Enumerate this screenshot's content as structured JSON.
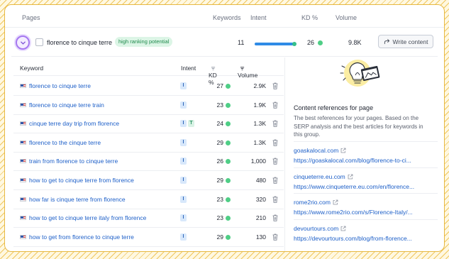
{
  "header": {
    "pages_label": "Pages",
    "keywords_label": "Keywords",
    "intent_label": "Intent",
    "kd_label": "KD %",
    "volume_label": "Volume"
  },
  "page_row": {
    "title": "florence to cinque terre",
    "badge": "high ranking potential",
    "keywords": "11",
    "intent_fill": 0.95,
    "kd": "26",
    "volume": "9.8K",
    "write_label": "Write content"
  },
  "table": {
    "columns": {
      "keyword": "Keyword",
      "intent": "Intent",
      "kd": "KD %",
      "volume": "Volume"
    },
    "rows": [
      {
        "keyword": "florence to cinque terre",
        "intents": [
          "I"
        ],
        "kd": "27",
        "volume": "2.9K"
      },
      {
        "keyword": "florence to cinque terre train",
        "intents": [
          "I"
        ],
        "kd": "23",
        "volume": "1.9K"
      },
      {
        "keyword": "cinque terre day trip from florence",
        "intents": [
          "I",
          "T"
        ],
        "kd": "24",
        "volume": "1.3K"
      },
      {
        "keyword": "florence to the cinque terre",
        "intents": [
          "I"
        ],
        "kd": "29",
        "volume": "1.3K"
      },
      {
        "keyword": "train from florence to cinque terre",
        "intents": [
          "I"
        ],
        "kd": "26",
        "volume": "1,000"
      },
      {
        "keyword": "how to get to cinque terre from florence",
        "intents": [
          "I"
        ],
        "kd": "29",
        "volume": "480"
      },
      {
        "keyword": "how far is cinque terre from florence",
        "intents": [
          "I"
        ],
        "kd": "23",
        "volume": "320"
      },
      {
        "keyword": "how to get to cinque terre italy from florence",
        "intents": [
          "I"
        ],
        "kd": "23",
        "volume": "210"
      },
      {
        "keyword": "how to get from florence to cinque terre",
        "intents": [
          "I"
        ],
        "kd": "29",
        "volume": "130"
      }
    ]
  },
  "references": {
    "title": "Content references for page",
    "description": "The best references for your pages. Based on the SERP analysis and the best articles for keywords in this group.",
    "items": [
      {
        "domain": "goaskalocal.com",
        "url": "https://goaskalocal.com/blog/florence-to-ci..."
      },
      {
        "domain": "cinqueterre.eu.com",
        "url": "https://www.cinqueterre.eu.com/en/florence..."
      },
      {
        "domain": "rome2rio.com",
        "url": "https://www.rome2rio.com/s/Florence-Italy/..."
      },
      {
        "domain": "devourtours.com",
        "url": "https://devourtours.com/blog/from-florence..."
      }
    ]
  },
  "colors": {
    "accent_link": "#1d5fc8",
    "kd_dot": "#4fce86",
    "badge_green": "#dcf5e6",
    "expand_ring": "#a678f0",
    "intent_bar": "#2f8be6"
  },
  "icons": {
    "expand": "chevron-down-icon",
    "write": "share-arrow-icon",
    "delete": "trash-icon",
    "external": "external-link-icon",
    "sort": "sort-icon",
    "flag": "us-flag-icon"
  }
}
